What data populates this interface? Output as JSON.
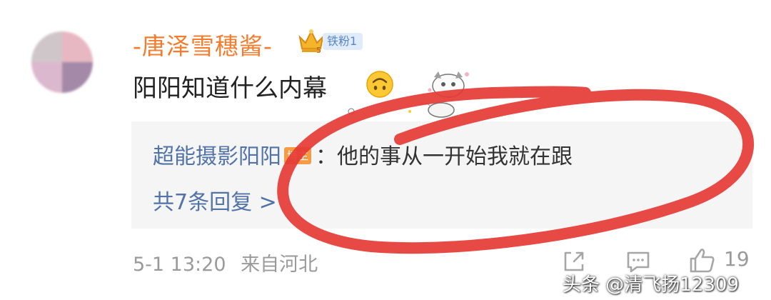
{
  "comment": {
    "username": "-唐泽雪穗酱-",
    "fan_badge": "铁粉1",
    "crown_level": "5",
    "text": "阳阳知道什么内幕",
    "reply_preview": {
      "author": "超能摄影阳阳",
      "author_badge": "博主",
      "text": "：他的事从一开始我就在跟"
    },
    "more_replies": "共7条回复 >",
    "timestamp": "5-1 13:20",
    "location": "来自河北",
    "like_count": "19"
  },
  "watermark": "头条 @清飞扬12309",
  "icons": {
    "crown": "crown-icon",
    "smile": "upside-down-smile-icon",
    "share": "share-icon",
    "comment": "comment-icon",
    "like": "thumbs-up-icon"
  },
  "colors": {
    "username": "#f47c2c",
    "link": "#5173a8",
    "badge_bg": "#e1ecfa",
    "blogger_badge": "#f59b44",
    "annotation": "#e53935"
  }
}
